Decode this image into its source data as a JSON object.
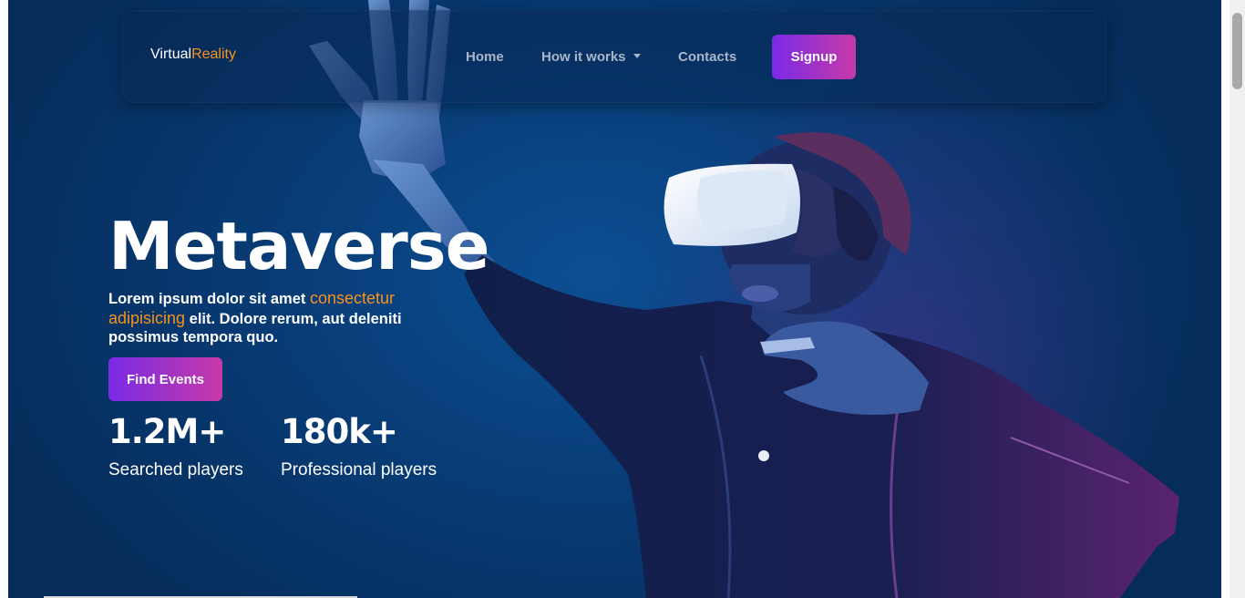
{
  "nav": {
    "brand_primary": "Virtual",
    "brand_accent": "Reality",
    "links": [
      "Home",
      "How it works",
      "Contacts"
    ],
    "signup_label": "Signup"
  },
  "hero": {
    "title": "Metaverse",
    "text_before": "Lorem ipsum dolor sit amet ",
    "text_highlight": "consectetur adipisicing",
    "text_after": " elit. Dolore rerum, aut deleniti possimus tempora quo.",
    "cta_label": "Find Events"
  },
  "stats": [
    {
      "value": "1.2M+",
      "label": "Searched players"
    },
    {
      "value": "180k+",
      "label": "Professional players"
    }
  ],
  "colors": {
    "accent": "#f7931e",
    "button_gradient_start": "#7a2ae6",
    "button_gradient_end": "#c63aa8",
    "background": "#083d78"
  }
}
